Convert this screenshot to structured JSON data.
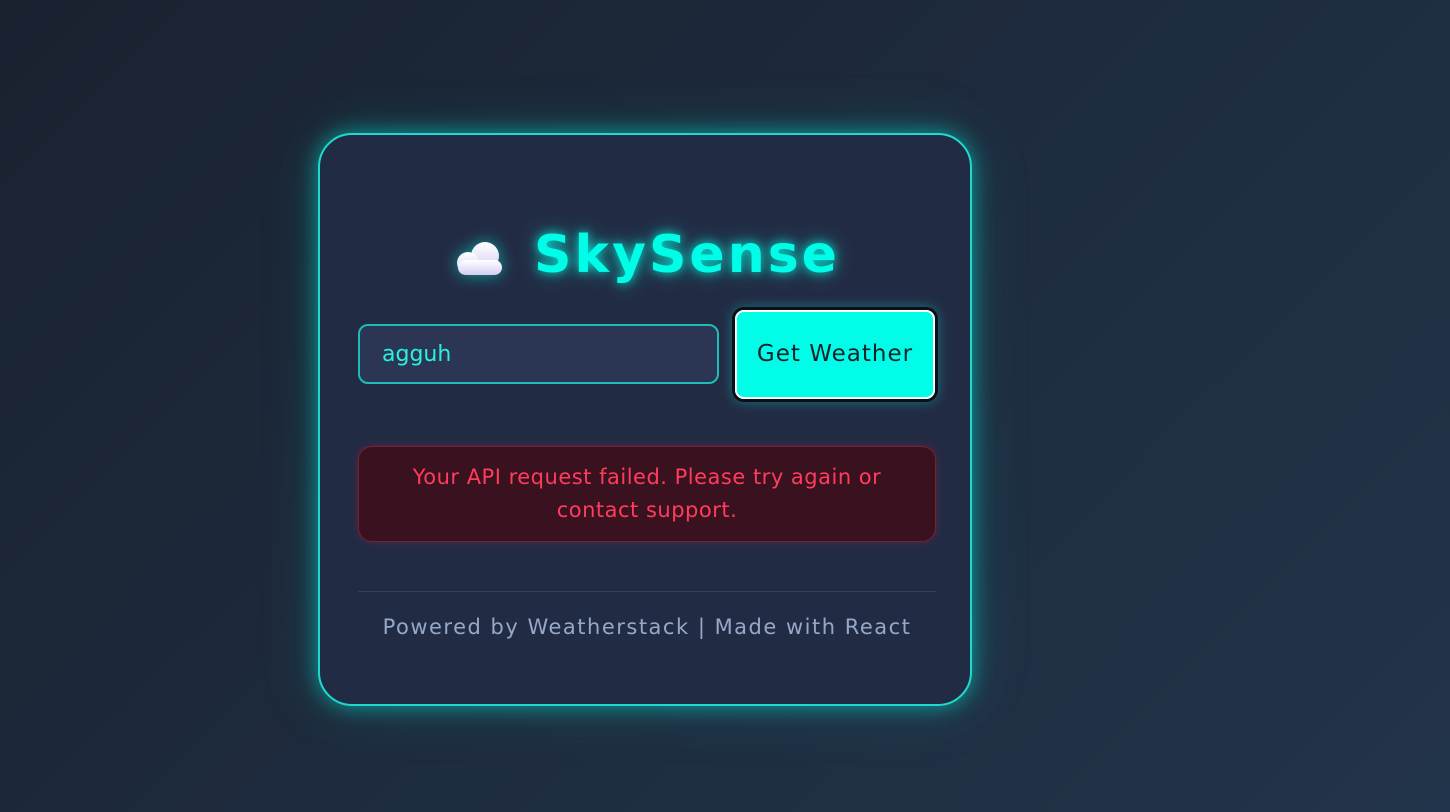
{
  "app": {
    "title": "SkySense",
    "logo_icon": "cloud-icon"
  },
  "search": {
    "value": "agguh",
    "button_label": "Get Weather"
  },
  "error": {
    "message": "Your API request failed. Please try again or contact support."
  },
  "footer": {
    "text": "Powered by Weatherstack | Made with React"
  },
  "colors": {
    "accent": "#00fde8",
    "card_border": "#1fd9cf",
    "error_text": "#ff3c5c",
    "error_bg": "#3a111f",
    "footer_text": "#95a8c8"
  }
}
